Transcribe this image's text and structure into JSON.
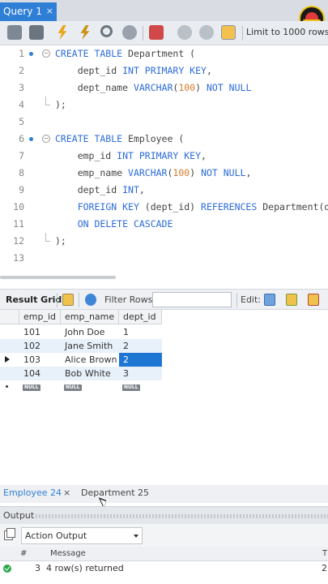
{
  "tab": {
    "title": "Query 1",
    "close": "×"
  },
  "toolbar": {
    "limit_label": "Limit to 1000 rows"
  },
  "editor": {
    "lines": [
      {
        "n": "1",
        "tokens": [
          [
            "kw",
            "CREATE TABLE "
          ],
          [
            "plain",
            "Department ("
          ]
        ]
      },
      {
        "n": "2",
        "tokens": [
          [
            "plain",
            "    dept_id "
          ],
          [
            "kw",
            "INT PRIMARY KEY"
          ],
          [
            "plain",
            ","
          ]
        ]
      },
      {
        "n": "3",
        "tokens": [
          [
            "plain",
            "    dept_name "
          ],
          [
            "kw",
            "VARCHAR"
          ],
          [
            "plain",
            "("
          ],
          [
            "num",
            "100"
          ],
          [
            "plain",
            ") "
          ],
          [
            "kw",
            "NOT NULL"
          ]
        ]
      },
      {
        "n": "4",
        "tokens": [
          [
            "plain",
            ");"
          ]
        ]
      },
      {
        "n": "5",
        "tokens": []
      },
      {
        "n": "6",
        "tokens": [
          [
            "kw",
            "CREATE TABLE "
          ],
          [
            "plain",
            "Employee ("
          ]
        ]
      },
      {
        "n": "7",
        "tokens": [
          [
            "plain",
            "    emp_id "
          ],
          [
            "kw",
            "INT PRIMARY KEY"
          ],
          [
            "plain",
            ","
          ]
        ]
      },
      {
        "n": "8",
        "tokens": [
          [
            "plain",
            "    emp_name "
          ],
          [
            "kw",
            "VARCHAR"
          ],
          [
            "plain",
            "("
          ],
          [
            "num",
            "100"
          ],
          [
            "plain",
            ") "
          ],
          [
            "kw",
            "NOT NULL"
          ],
          [
            "plain",
            ","
          ]
        ]
      },
      {
        "n": "9",
        "tokens": [
          [
            "plain",
            "    dept_id "
          ],
          [
            "kw",
            "INT"
          ],
          [
            "plain",
            ","
          ]
        ]
      },
      {
        "n": "10",
        "tokens": [
          [
            "plain",
            "    "
          ],
          [
            "kw",
            "FOREIGN KEY "
          ],
          [
            "plain",
            "(dept_id) "
          ],
          [
            "kw",
            "REFERENCES "
          ],
          [
            "plain",
            "Department(dept_id)"
          ]
        ]
      },
      {
        "n": "11",
        "tokens": [
          [
            "plain",
            "    "
          ],
          [
            "kw",
            "ON DELETE CASCADE"
          ]
        ]
      },
      {
        "n": "12",
        "tokens": [
          [
            "plain",
            ");"
          ]
        ]
      },
      {
        "n": "13",
        "tokens": []
      }
    ]
  },
  "result_grid": {
    "title": "Result Grid",
    "filter_label": "Filter Rows:",
    "filter_value": "",
    "edit_label": "Edit:",
    "columns": [
      "emp_id",
      "emp_name",
      "dept_id"
    ],
    "rows": [
      [
        "101",
        "John Doe",
        "1"
      ],
      [
        "102",
        "Jane Smith",
        "2"
      ],
      [
        "103",
        "Alice Brown",
        "2"
      ],
      [
        "104",
        "Bob White",
        "3"
      ]
    ],
    "null_label": "NULL"
  },
  "result_tabs": [
    {
      "label": "Employee 24",
      "close": "×"
    },
    {
      "label": "Department 25"
    }
  ],
  "output": {
    "title": "Output",
    "action_select": "Action Output",
    "col_hash": "#",
    "col_message": "Message",
    "col_t": "T",
    "row": {
      "num": "3",
      "message": "4 row(s) returned",
      "duration": "2"
    }
  },
  "colors": {
    "accent": "#2f7fd6",
    "keyword": "#2c6bd9",
    "number": "#d77a2b",
    "selection": "#1e76d3"
  },
  "icons": [
    "close-icon",
    "folder-icon",
    "save-icon",
    "execute-icon",
    "execute-current-icon",
    "explain-icon",
    "stop-icon",
    "toggle-icon",
    "commit-icon",
    "rollback-icon",
    "autocommit-icon",
    "refresh-icon",
    "copy-icon",
    "success-icon"
  ]
}
